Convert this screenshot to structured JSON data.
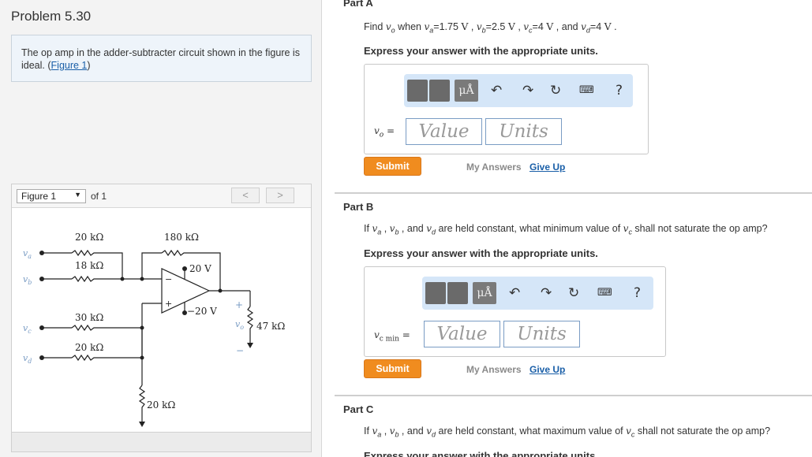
{
  "problem": {
    "title": "Problem 5.30",
    "text": "The op amp in the adder-subtracter circuit shown in the figure is ideal.",
    "figure_link": "Figure 1"
  },
  "figure": {
    "select_value": "Figure 1",
    "of_text": "of 1",
    "prev": "<",
    "next": ">",
    "labels": {
      "r_a": "20 kΩ",
      "r_b": "18 kΩ",
      "r_c": "30 kΩ",
      "r_d": "20 kΩ",
      "r_f": "180 kΩ",
      "r_g": "20 kΩ",
      "r_l": "47 kΩ",
      "supply_pos": "20 V",
      "supply_neg": "−20 V",
      "v_a": "v",
      "v_a_sub": "a",
      "v_b": "v",
      "v_b_sub": "b",
      "v_c": "v",
      "v_c_sub": "c",
      "v_d": "v",
      "v_d_sub": "d",
      "v_o": "v",
      "v_o_sub": "o",
      "plus": "+",
      "minus": "−",
      "op_minus": "−",
      "op_plus": "+"
    }
  },
  "partA": {
    "title": "Part A",
    "question_prefix": "Find",
    "vo": "v",
    "vo_sub": "o",
    "when": "when",
    "va": "v",
    "va_sub": "a",
    "va_val": "=1.75",
    "vb": "v",
    "vb_sub": "b",
    "vb_val": "=2.5",
    "vc": "v",
    "vc_sub": "c",
    "vc_val": "=4",
    "vd": "v",
    "vd_sub": "d",
    "vd_val": "=4",
    "unit": "V",
    "and": "and",
    "instruction": "Express your answer with the appropriate units.",
    "answer_label": "v",
    "answer_label_sub": "o",
    "answer_eq": " =",
    "value_placeholder": "Value",
    "units_placeholder": "Units",
    "submit": "Submit",
    "my_answers": "My Answers",
    "give_up": "Give Up"
  },
  "partB": {
    "title": "Part B",
    "question": "If",
    "va": "v",
    "va_sub": "a",
    "vb": "v",
    "vb_sub": "b",
    "vd": "v",
    "vd_sub": "d",
    "and": "and",
    "rest": "are held constant, what minimum value of",
    "vc": "v",
    "vc_sub": "c",
    "end": "shall not saturate the op amp?",
    "instruction": "Express your answer with the appropriate units.",
    "answer_label": "v",
    "answer_label_sub": "c min",
    "answer_eq": " =",
    "value_placeholder": "Value",
    "units_placeholder": "Units",
    "submit": "Submit",
    "my_answers": "My Answers",
    "give_up": "Give Up"
  },
  "partC": {
    "title": "Part C",
    "question": "If",
    "va": "v",
    "va_sub": "a",
    "vb": "v",
    "vb_sub": "b",
    "vd": "v",
    "vd_sub": "d",
    "and": "and",
    "rest": "are held constant, what maximum value of",
    "vc": "v",
    "vc_sub": "c",
    "end": "shall not saturate the op amp?",
    "instruction": "Express your answer with the appropriate units."
  },
  "toolbar": {
    "units_btn": "μÅ",
    "help": "?"
  }
}
